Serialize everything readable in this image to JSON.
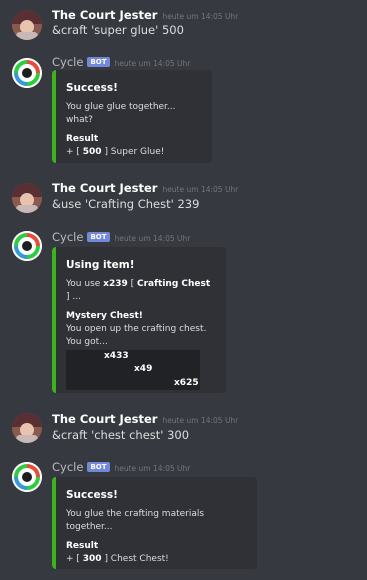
{
  "messages": [
    {
      "author": "The Court Jester",
      "timestamp": "heute um 14:05 Uhr",
      "text": "&craft 'super glue' 500"
    },
    {
      "author": "Cycle",
      "badge": "BOT",
      "timestamp": "heute um 14:05 Uhr",
      "embed": {
        "title": "Success!",
        "description": "You glue glue together... what?",
        "field_name": "Result",
        "field_prefix": "+ [ ",
        "field_amount": "500",
        "field_suffix": " ] Super Glue!",
        "accent": "#3bb31e"
      }
    },
    {
      "author": "The Court Jester",
      "timestamp": "heute um 14:05 Uhr",
      "text": "&use 'Crafting Chest' 239"
    },
    {
      "author": "Cycle",
      "badge": "BOT",
      "timestamp": "heute um 14:05 Uhr",
      "embed": {
        "title": "Using item!",
        "use_prefix": "You use ",
        "use_count": "x239",
        "use_mid": " [ ",
        "use_item": "Crafting Chest",
        "use_suffix": " ] ...",
        "field_name": "Mystery Chest!",
        "line1": "You open up the crafting chest.",
        "line2": "You got...",
        "counts": [
          "x433",
          "x49",
          "x625"
        ],
        "accent": "#3bb31e"
      }
    },
    {
      "author": "The Court Jester",
      "timestamp": "heute um 14:05 Uhr",
      "text": "&craft 'chest chest' 300"
    },
    {
      "author": "Cycle",
      "badge": "BOT",
      "timestamp": "heute um 14:05 Uhr",
      "embed": {
        "title": "Success!",
        "description": "You glue the crafting materials together...",
        "field_name": "Result",
        "field_prefix": "+ [ ",
        "field_amount": "300",
        "field_suffix": " ] Chest Chest!",
        "accent": "#3bb31e"
      }
    }
  ]
}
